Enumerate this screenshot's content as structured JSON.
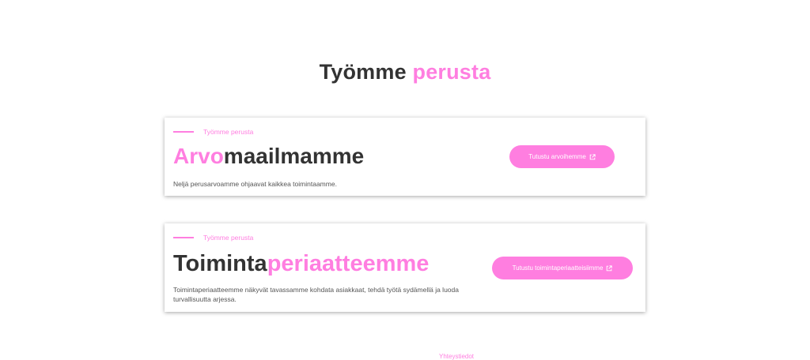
{
  "hero": {
    "title_dark": "Työmme",
    "title_pink": "perusta"
  },
  "cards": [
    {
      "eyebrow": "Työmme perusta",
      "title_pink": "Arvo",
      "title_dark": "maailmamme",
      "description": "Neljä perusarvoamme ohjaavat kaikkea toimintaamme.",
      "button_label": "Tutustu arvoihemme",
      "button_icon": "external-link-icon"
    },
    {
      "eyebrow": "Työmme perusta",
      "title_dark": "Toiminta",
      "title_pink": "periaatteemme",
      "description": "Toimintaperiaatteemme näkyvät tavassamme kohdata asiakkaat, tehdä työtä sydämellä ja luoda turvallisuutta arjessa.",
      "button_label": "Tutustu toimintaperiaatteisiimme",
      "button_icon": "external-link-icon"
    }
  ],
  "next_section": {
    "label": "Yhteystiedot"
  },
  "colors": {
    "accent": "#ff7ee0",
    "text": "#333333"
  }
}
